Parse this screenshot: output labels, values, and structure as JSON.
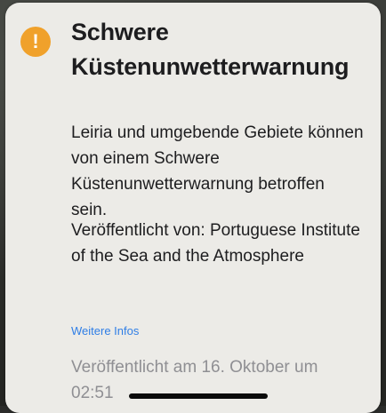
{
  "alert": {
    "icon": "exclamation-icon",
    "icon_glyph": "!",
    "icon_color": "#f0a12b",
    "title": "Schwere Küstenunwetterwarnung",
    "description": "Leiria und umgebende Gebiete können von einem Schwere Küstenunwetterwarnung betroffen sein.",
    "issuer": "Veröffentlicht von: Portuguese Institute of the Sea and the Atmosphere",
    "more_info_label": "Weitere Infos",
    "link_color": "#2f7ee6",
    "published": "Veröffentlicht am 16. Oktober um 02:51"
  }
}
